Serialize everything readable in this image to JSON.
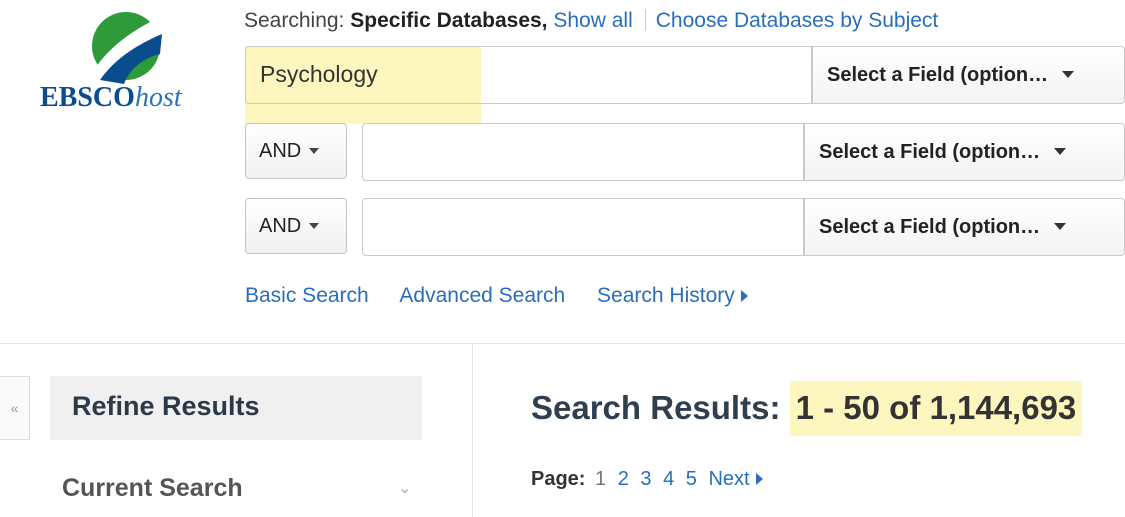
{
  "brand": {
    "logo_main": "EBSCO",
    "logo_suffix": "host",
    "colors": {
      "green": "#2e9a3a",
      "blue": "#0b4d8c",
      "link": "#2a6ebb",
      "highlight": "#fdf6bf"
    }
  },
  "searching": {
    "prefix": "Searching:",
    "databases": "Specific Databases,",
    "show_all": "Show all",
    "choose_by_subject": "Choose Databases by Subject"
  },
  "rows": [
    {
      "bool": "",
      "term": "Psychology",
      "field": "Select a Field (option…"
    },
    {
      "bool": "AND",
      "term": "",
      "field": "Select a Field (option…"
    },
    {
      "bool": "AND",
      "term": "",
      "field": "Select a Field (option…"
    }
  ],
  "links": {
    "basic": "Basic Search",
    "advanced": "Advanced Search",
    "history": "Search History"
  },
  "left_panel": {
    "collapse_glyph": "«",
    "refine_title": "Refine Results",
    "current_search": "Current Search",
    "chevron_glyph": "⌄"
  },
  "results": {
    "label": "Search Results:",
    "range": "1 - 50 of 1,144,693"
  },
  "pager": {
    "label": "Page:",
    "current": "1",
    "pages": [
      "2",
      "3",
      "4",
      "5"
    ],
    "next": "Next"
  }
}
